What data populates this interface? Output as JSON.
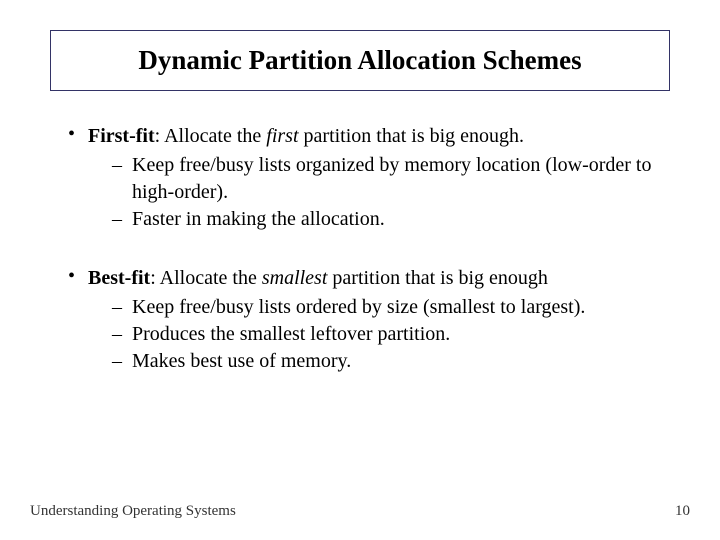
{
  "title": "Dynamic Partition Allocation Schemes",
  "items": [
    {
      "label": "First-fit",
      "desc_before": ":  Allocate the ",
      "em": "first",
      "desc_after": " partition that is big enough.",
      "subs": [
        "Keep free/busy lists organized by memory location (low-order to high-order).",
        "Faster in making the allocation."
      ]
    },
    {
      "label": "Best-fit",
      "desc_before": ":  Allocate the ",
      "em": "smallest",
      "desc_after": " partition that is big enough",
      "subs": [
        " Keep free/busy lists ordered by size (smallest to largest).",
        "Produces the smallest leftover partition.",
        "Makes best use of memory."
      ]
    }
  ],
  "footer_left": "Understanding Operating Systems",
  "footer_right": "10"
}
